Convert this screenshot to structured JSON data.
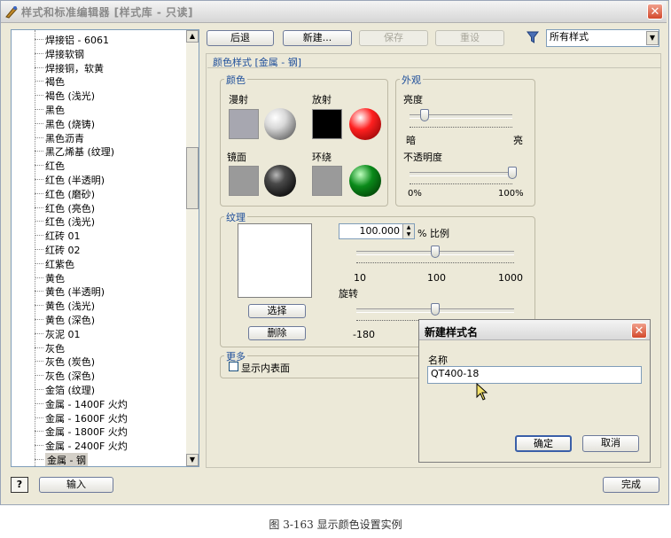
{
  "window": {
    "title": "样式和标准编辑器 [样式库 - 只读]"
  },
  "toolbar": {
    "back": "后退",
    "new": "新建...",
    "save": "保存",
    "reset": "重设",
    "filter_value": "所有样式"
  },
  "style_list": {
    "items": [
      "焊接铝 - 6061",
      "焊接软钢",
      "焊接铜，软黄",
      "褐色",
      "褐色 (浅光)",
      "黑色",
      "黑色 (烧铸)",
      "黑色沥青",
      "黑乙烯基 (纹理)",
      "红色",
      "红色 (半透明)",
      "红色 (磨砂)",
      "红色 (亮色)",
      "红色 (浅光)",
      "红砖 01",
      "红砖 02",
      "红紫色",
      "黄色",
      "黄色 (半透明)",
      "黄色 (浅光)",
      "黄色 (深色)",
      "灰泥 01",
      "灰色",
      "灰色 (炭色)",
      "灰色 (深色)",
      "金箔 (纹理)",
      "金属 - 1400F 火灼",
      "金属 - 1600F 火灼",
      "金属 - 1800F 火灼",
      "金属 - 2400F 火灼",
      "金属 - 钢"
    ],
    "selected": "金属 - 钢"
  },
  "panel": {
    "header": "颜色样式 [金属 - 钢]",
    "color": {
      "title": "颜色",
      "diffuse": "漫射",
      "emissive": "放射",
      "specular": "镜面",
      "ambient": "环绕",
      "diffuse_color": "#a7a7b0",
      "emissive_color": "#000000",
      "specular_color": "#9a9a9a",
      "ambient_color": "#9a9a9a",
      "emissive_sphere_color": "#ff2020",
      "ambient_sphere_color": "#0a8a1a"
    },
    "appearance": {
      "title": "外观",
      "brightness": "亮度",
      "dark": "暗",
      "bright": "亮",
      "brightness_value": 0.15,
      "opacity": "不透明度",
      "opacity_min": "0%",
      "opacity_max": "100%",
      "opacity_value": 1.0
    },
    "texture": {
      "title": "纹理",
      "scale_value": "100.000",
      "scale_label": "% 比例",
      "scale_ticks": [
        "10",
        "100",
        "1000"
      ],
      "scale_pos": 0.5,
      "rotate_label": "旋转",
      "rotate_min": "-180",
      "rotate_pos": 0.5,
      "select": "选择",
      "delete": "删除"
    },
    "more": {
      "title": "更多",
      "show_inside": "显示内表面",
      "show_inside_checked": false
    }
  },
  "dialog": {
    "title": "新建样式名",
    "name_label": "名称",
    "name_value": "QT400-18",
    "ok": "确定",
    "cancel": "取消"
  },
  "footer": {
    "help": "?",
    "import": "输入",
    "done": "完成"
  },
  "caption": "图 3-163  显示颜色设置实例"
}
